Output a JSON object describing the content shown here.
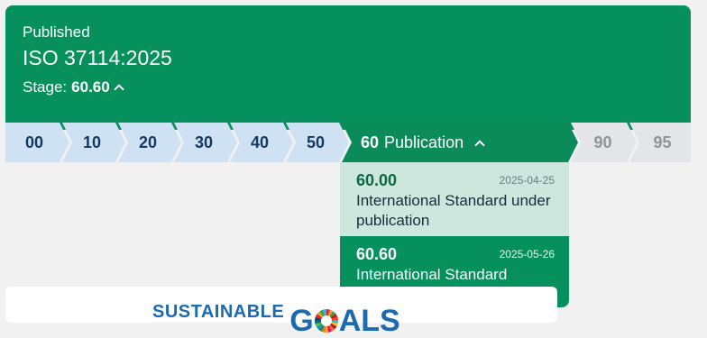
{
  "header": {
    "status": "Published",
    "standard_id": "ISO 37114:2025",
    "stage_label": "Stage:",
    "stage_value": "60.60"
  },
  "stages": {
    "s00": "00",
    "s10": "10",
    "s20": "20",
    "s30": "30",
    "s40": "40",
    "s50": "50",
    "s60_num": "60",
    "s60_name": "Publication",
    "s90": "90",
    "s95": "95"
  },
  "dropdown": {
    "items": [
      {
        "code": "60.00",
        "date": "2025-04-25",
        "description": "International Standard under publication"
      },
      {
        "code": "60.60",
        "date": "2025-05-26",
        "description": "International Standard published"
      }
    ]
  },
  "sdg": {
    "word1": "SUSTAINABLE",
    "word2_a": "G",
    "word2_b": "ALS"
  },
  "colors": {
    "brand_green": "#05905e",
    "past_stage": "#cfe2f3",
    "future_stage": "#e3e5e8",
    "dropdown_light": "#cde7de"
  },
  "icons": {
    "stage_toggle": "chevron-up-icon",
    "publication_toggle": "chevron-up-icon",
    "sdg_wheel": "sdg-wheel-icon"
  }
}
